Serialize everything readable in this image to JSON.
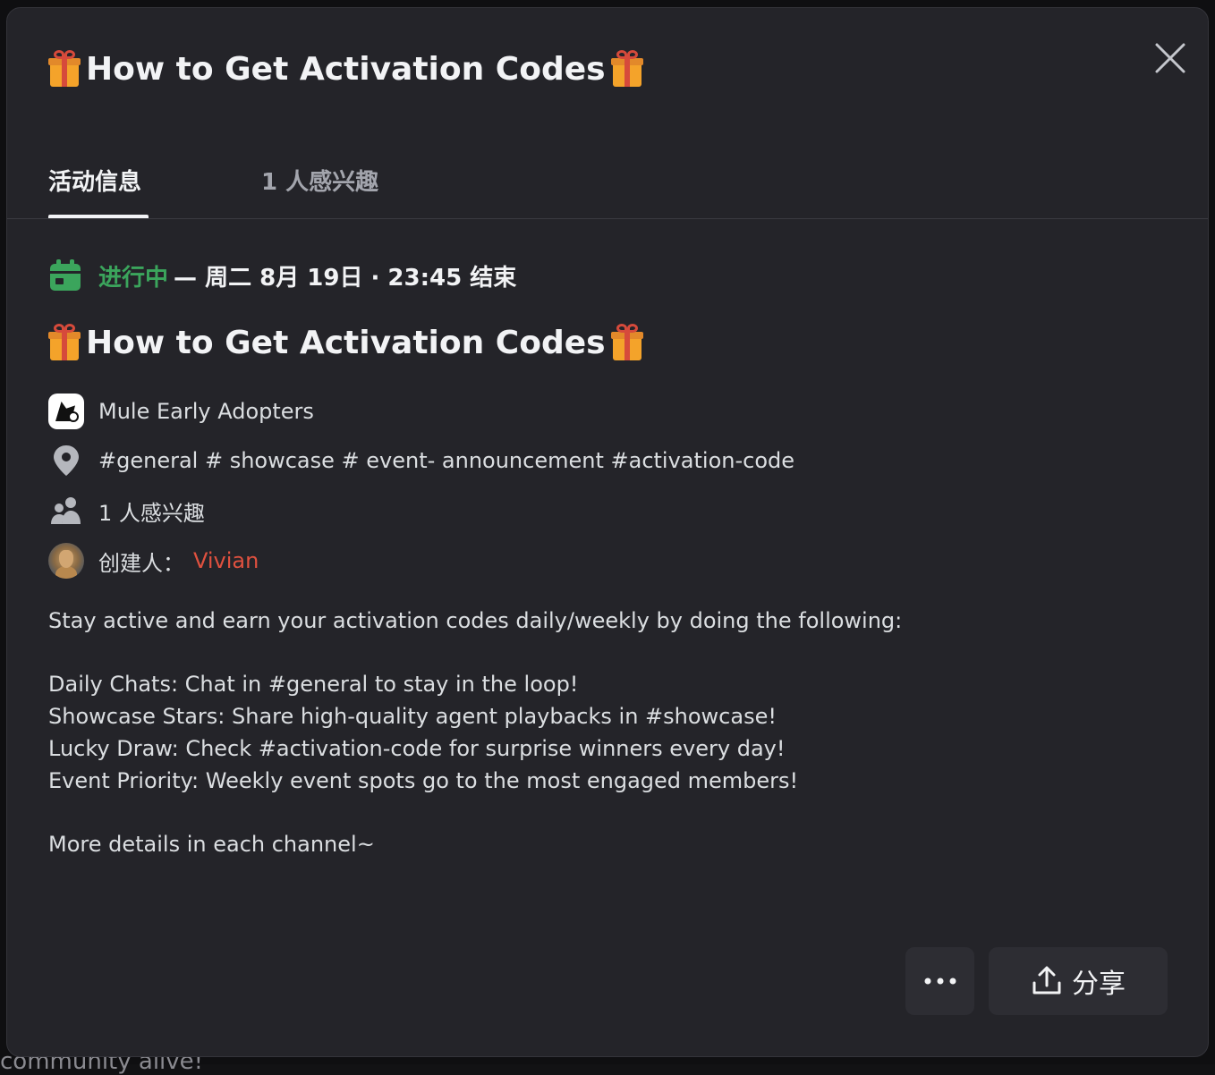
{
  "modal": {
    "header_title": "How to Get Activation Codes",
    "close_label": "×"
  },
  "tabs": [
    {
      "label": "活动信息"
    },
    {
      "label": "1 人感兴趣"
    }
  ],
  "status": {
    "live": "进行中",
    "rest": "— 周二 8月 19日 · 23:45 结束"
  },
  "event": {
    "title": "How to Get Activation Codes",
    "server_name": "Mule Early Adopters",
    "location": "#general # showcase # event- announcement #activation-code",
    "interested": "1 人感兴趣",
    "creator_prefix": "创建人：",
    "creator_name": "Vivian"
  },
  "description": "Stay active and earn your activation codes daily/weekly by doing the following:\n\nDaily Chats: Chat in #general to stay in the loop!\nShowcase Stars: Share high-quality agent playbacks in #showcase!\nLucky Draw: Check #activation-code for surprise winners every day!\nEvent Priority: Weekly event spots go to the most engaged members!\n\nMore details in each channel~",
  "actions": {
    "more_label": "•••",
    "share_label": "分享"
  },
  "colors": {
    "accent_green": "#3ba55c",
    "creator_red": "#e0513f",
    "background": "#242429"
  },
  "background_peek_text": "community alive!"
}
